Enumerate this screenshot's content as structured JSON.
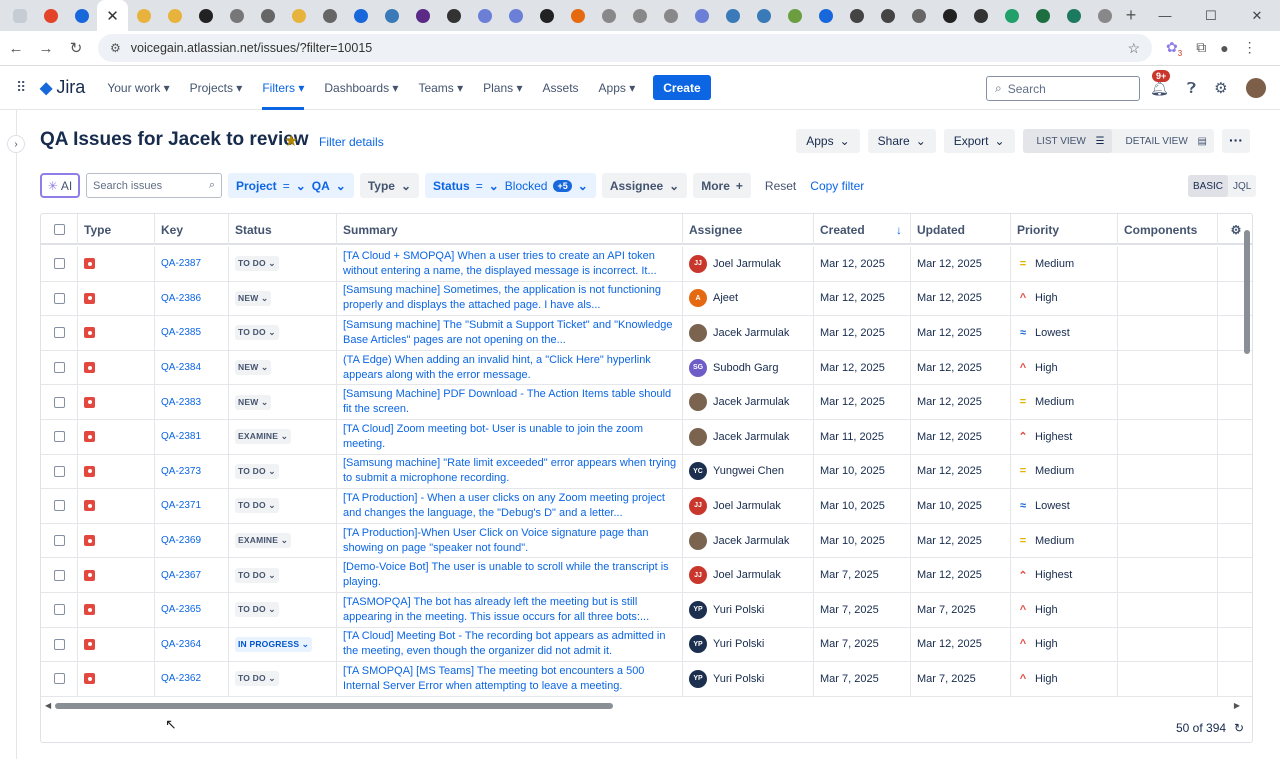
{
  "browser": {
    "url": "voicegain.atlassian.net/issues/?filter=10015",
    "tab_close": "✕",
    "win_controls": [
      "—",
      "☐",
      "✕"
    ],
    "ext_badge": "3"
  },
  "nav": {
    "logo": "Jira",
    "items": [
      "Your work",
      "Projects",
      "Filters",
      "Dashboards",
      "Teams",
      "Plans",
      "Assets",
      "Apps"
    ],
    "create": "Create",
    "search_placeholder": "Search",
    "notif_badge": "9+"
  },
  "page": {
    "title": "QA Issues for Jacek to review",
    "filter_details": "Filter details",
    "apps": "Apps",
    "share": "Share",
    "export": "Export",
    "list_view": "LIST VIEW",
    "detail_view": "DETAIL VIEW"
  },
  "filters": {
    "ai": "AI",
    "search_placeholder": "Search issues",
    "project_label": "Project",
    "project_op": "=",
    "project_value": "QA",
    "type_label": "Type",
    "status_label": "Status",
    "status_op": "=",
    "status_value": "Blocked",
    "status_more": "+5",
    "assignee_label": "Assignee",
    "more_label": "More",
    "reset": "Reset",
    "copy_filter": "Copy filter",
    "basic": "BASIC",
    "jql": "JQL"
  },
  "table": {
    "columns": [
      "Type",
      "Key",
      "Status",
      "Summary",
      "Assignee",
      "Created",
      "Updated",
      "Priority",
      "Components"
    ],
    "rows": [
      {
        "key": "QA-2387",
        "status": "TO DO",
        "summary": "[TA Cloud + SMOPQA] When a user tries to create an API token without entering a name, the displayed message is incorrect. It...",
        "assignee": "Joel Jarmulak",
        "initials": "JJ",
        "avcolor": "#c9372c",
        "created": "Mar 12, 2025",
        "updated": "Mar 12, 2025",
        "priority": "Medium"
      },
      {
        "key": "QA-2386",
        "status": "NEW",
        "summary": "[Samsung machine] Sometimes, the application is not functioning properly and displays the attached page. I have als...",
        "assignee": "Ajeet",
        "initials": "A",
        "avcolor": "#e56910",
        "created": "Mar 12, 2025",
        "updated": "Mar 12, 2025",
        "priority": "High"
      },
      {
        "key": "QA-2385",
        "status": "TO DO",
        "summary": "[Samsung machine] The \"Submit a Support Ticket\" and \"Knowledge Base Articles\" pages are not opening on the...",
        "assignee": "Jacek Jarmulak",
        "initials": "",
        "avcolor": "#7a6450",
        "created": "Mar 12, 2025",
        "updated": "Mar 12, 2025",
        "priority": "Lowest"
      },
      {
        "key": "QA-2384",
        "status": "NEW",
        "summary": "(TA Edge) When adding an invalid hint, a \"Click Here\" hyperlink appears along with the error message.",
        "assignee": "Subodh Garg",
        "initials": "SG",
        "avcolor": "#6e5dc6",
        "created": "Mar 12, 2025",
        "updated": "Mar 12, 2025",
        "priority": "High"
      },
      {
        "key": "QA-2383",
        "status": "NEW",
        "summary": "[Samsung Machine] PDF Download - The Action Items table should fit the screen.",
        "assignee": "Jacek Jarmulak",
        "initials": "",
        "avcolor": "#7a6450",
        "created": "Mar 12, 2025",
        "updated": "Mar 12, 2025",
        "priority": "Medium"
      },
      {
        "key": "QA-2381",
        "status": "EXAMINE",
        "summary": "[TA Cloud] Zoom meeting bot- User is unable to join the zoom meeting.",
        "assignee": "Jacek Jarmulak",
        "initials": "",
        "avcolor": "#7a6450",
        "created": "Mar 11, 2025",
        "updated": "Mar 12, 2025",
        "priority": "Highest"
      },
      {
        "key": "QA-2373",
        "status": "TO DO",
        "summary": "[Samsung machine] \"Rate limit exceeded\" error appears when trying to submit a microphone recording.",
        "assignee": "Yungwei Chen",
        "initials": "YC",
        "avcolor": "#1d2f4f",
        "created": "Mar 10, 2025",
        "updated": "Mar 12, 2025",
        "priority": "Medium"
      },
      {
        "key": "QA-2371",
        "status": "TO DO",
        "summary": "[TA Production] - When a user clicks on any Zoom meeting project and changes the language, the \"Debug's D\" and a letter...",
        "assignee": "Joel Jarmulak",
        "initials": "JJ",
        "avcolor": "#c9372c",
        "created": "Mar 10, 2025",
        "updated": "Mar 10, 2025",
        "priority": "Lowest"
      },
      {
        "key": "QA-2369",
        "status": "EXAMINE",
        "summary": "[TA Production]-When User Click on Voice signature page than showing on page \"speaker not found\".",
        "assignee": "Jacek Jarmulak",
        "initials": "",
        "avcolor": "#7a6450",
        "created": "Mar 10, 2025",
        "updated": "Mar 12, 2025",
        "priority": "Medium"
      },
      {
        "key": "QA-2367",
        "status": "TO DO",
        "summary": "[Demo-Voice Bot] The user is unable to scroll while the transcript is playing.",
        "assignee": "Joel Jarmulak",
        "initials": "JJ",
        "avcolor": "#c9372c",
        "created": "Mar 7, 2025",
        "updated": "Mar 12, 2025",
        "priority": "Highest"
      },
      {
        "key": "QA-2365",
        "status": "TO DO",
        "summary": "[TASMOPQA] The bot has already left the meeting but is still appearing in the meeting. This issue occurs for all three bots:...",
        "assignee": "Yuri Polski",
        "initials": "YP",
        "avcolor": "#1d2f4f",
        "created": "Mar 7, 2025",
        "updated": "Mar 7, 2025",
        "priority": "High"
      },
      {
        "key": "QA-2364",
        "status": "IN PROGRESS",
        "summary": "[TA Cloud] Meeting Bot - The recording bot appears as admitted in the meeting, even though the organizer did not admit it.",
        "assignee": "Yuri Polski",
        "initials": "YP",
        "avcolor": "#1d2f4f",
        "created": "Mar 7, 2025",
        "updated": "Mar 12, 2025",
        "priority": "High"
      },
      {
        "key": "QA-2362",
        "status": "TO DO",
        "summary": "[TA SMOPQA] [MS Teams] The meeting bot encounters a 500 Internal Server Error when attempting to leave a meeting.",
        "assignee": "Yuri Polski",
        "initials": "YP",
        "avcolor": "#1d2f4f",
        "created": "Mar 7, 2025",
        "updated": "Mar 7, 2025",
        "priority": "High"
      }
    ]
  },
  "priority_icons": {
    "Medium": "=",
    "High": "^",
    "Lowest": "≈",
    "Highest": "⌃"
  },
  "priority_colors": {
    "Medium": "#e2b203",
    "High": "#e2483d",
    "Lowest": "#1868db",
    "Highest": "#e2483d"
  },
  "footer": {
    "count": "50 of 394",
    "refresh": "↻"
  }
}
